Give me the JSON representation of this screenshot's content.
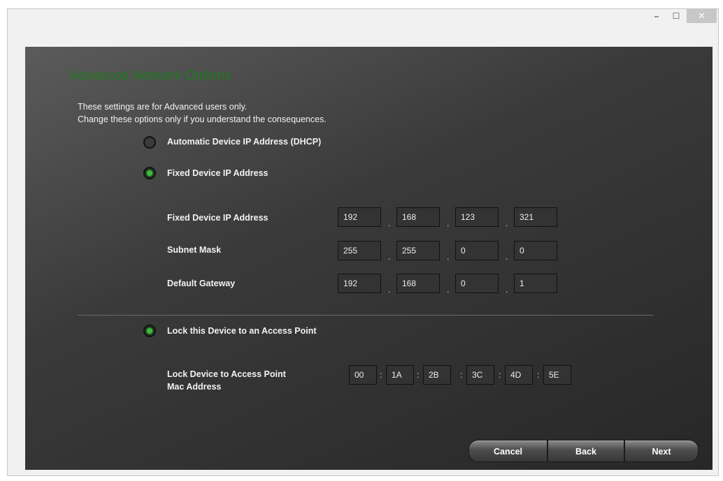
{
  "window": {
    "minimize_glyph": "–",
    "maximize_glyph": "☐",
    "close_glyph": "✕"
  },
  "page": {
    "heading": "Advanced Network Options",
    "note_line1": "These settings are for Advanced users only.",
    "note_line2": "Change these options only if you understand the consequences."
  },
  "ip_mode": {
    "options": [
      {
        "label": "Automatic Device IP Address (DHCP)",
        "selected": false
      },
      {
        "label": "Fixed Device IP Address",
        "selected": true
      }
    ]
  },
  "fields": {
    "fixed_ip": {
      "label": "Fixed Device IP Address",
      "octets": [
        "192",
        "168",
        "123",
        "321"
      ]
    },
    "subnet": {
      "label": "Subnet Mask",
      "octets": [
        "255",
        "255",
        "0",
        "0"
      ]
    },
    "gateway": {
      "label": "Default Gateway",
      "octets": [
        "192",
        "168",
        "0",
        "1"
      ]
    }
  },
  "lock": {
    "radio_label": "Lock this Device to an Access Point",
    "selected": true,
    "field_label_line1": "Lock Device to Access Point",
    "field_label_line2": "Mac Address",
    "mac": [
      "00",
      "1A",
      "2B",
      "3C",
      "4D",
      "5E"
    ]
  },
  "separators": {
    "ip": ".",
    "mac": ":"
  },
  "buttons": {
    "cancel": "Cancel",
    "back": "Back",
    "next": "Next"
  },
  "colors": {
    "heading": "#1f7a1f",
    "radio_selected": "#3bbb3b"
  }
}
